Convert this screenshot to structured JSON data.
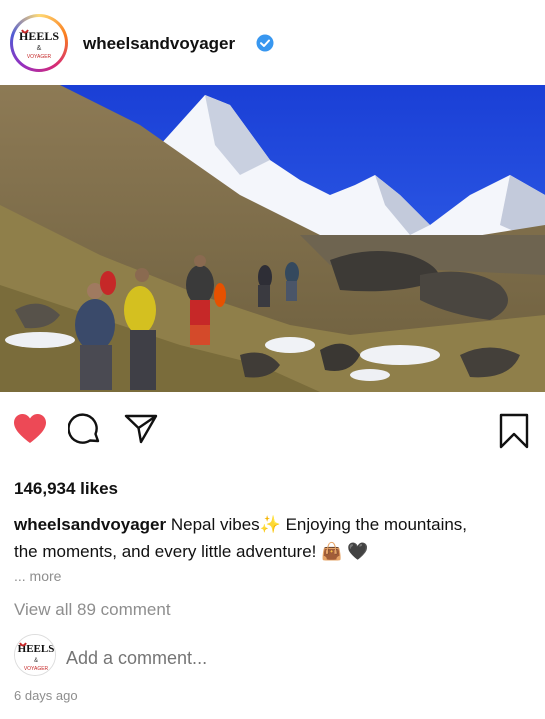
{
  "post": {
    "username": "wheelsandvoyager",
    "verified_icon": "verified-badge-icon",
    "avatar_text": "WHEELS",
    "image_alt": "trekkers walking toward snow-capped mountain",
    "likes": "146,934 likes",
    "caption_user": "wheelsandvoyager",
    "caption_line1": "Nepal vibes✨ Enjoying the mountains,",
    "caption_line2": "the moments, and every little adventure! 👜 🖤",
    "more": "... more",
    "view_all_comments": "View all 89 comment",
    "comment_placeholder": "Add a comment...",
    "time_ago": "6 days ago"
  },
  "colors": {
    "like": "#ed4956",
    "verified": "#3897f0",
    "muted": "#8e8e8e"
  }
}
